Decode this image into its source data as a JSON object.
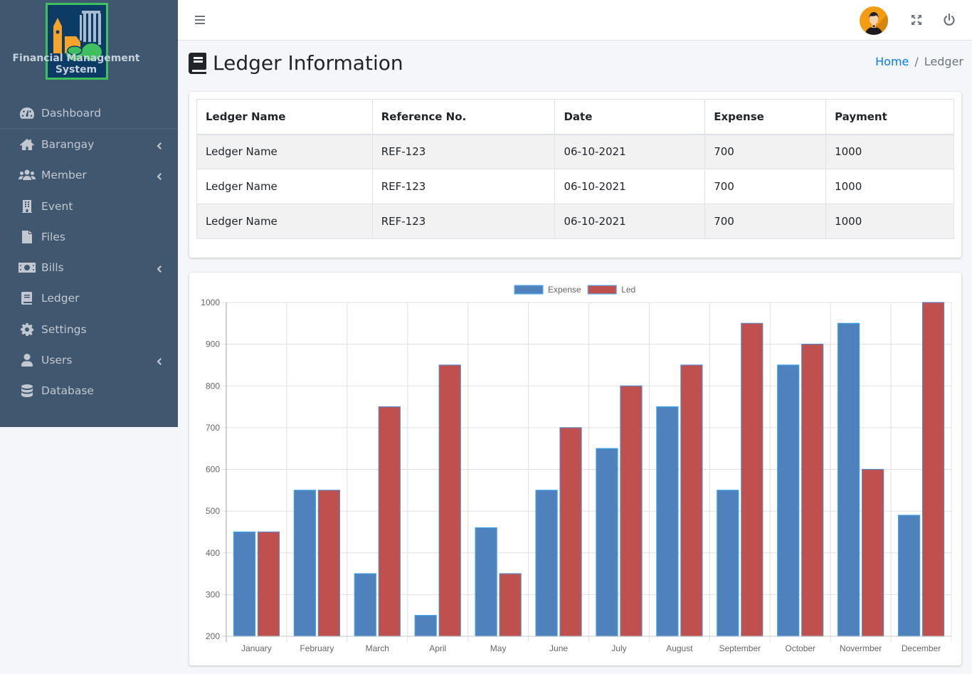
{
  "brand": {
    "title_line1": "Financial Management",
    "title_line2": "System"
  },
  "sidebar": {
    "items": [
      {
        "label": "Dashboard",
        "icon": "tachometer-icon",
        "has_submenu": false
      },
      {
        "label": "Barangay",
        "icon": "home-icon",
        "has_submenu": true
      },
      {
        "label": "Member",
        "icon": "users-icon",
        "has_submenu": true
      },
      {
        "label": "Event",
        "icon": "building-icon",
        "has_submenu": false
      },
      {
        "label": "Files",
        "icon": "file-icon",
        "has_submenu": false
      },
      {
        "label": "Bills",
        "icon": "money-bill-icon",
        "has_submenu": true
      },
      {
        "label": "Ledger",
        "icon": "book-icon",
        "has_submenu": false
      },
      {
        "label": "Settings",
        "icon": "gear-icon",
        "has_submenu": false
      },
      {
        "label": "Users",
        "icon": "user-icon",
        "has_submenu": true
      },
      {
        "label": "Database",
        "icon": "database-icon",
        "has_submenu": false
      }
    ]
  },
  "topbar": {
    "menu_icon": "hamburger-icon",
    "avatar": "user-avatar",
    "fullscreen_icon": "expand-icon",
    "logout_icon": "power-icon"
  },
  "page": {
    "title": "Ledger Information",
    "title_icon": "book-icon",
    "breadcrumb": {
      "home": "Home",
      "separator": "/",
      "current": "Ledger"
    }
  },
  "table": {
    "columns": [
      "Ledger Name",
      "Reference No.",
      "Date",
      "Expense",
      "Payment"
    ],
    "rows": [
      [
        "Ledger Name",
        "REF-123",
        "06-10-2021",
        "700",
        "1000"
      ],
      [
        "Ledger Name",
        "REF-123",
        "06-10-2021",
        "700",
        "1000"
      ],
      [
        "Ledger Name",
        "REF-123",
        "06-10-2021",
        "700",
        "1000"
      ]
    ]
  },
  "chart_data": {
    "type": "bar",
    "title": "",
    "xlabel": "",
    "ylabel": "",
    "categories": [
      "January",
      "February",
      "March",
      "April",
      "May",
      "June",
      "July",
      "August",
      "September",
      "October",
      "Novermber",
      "December"
    ],
    "series": [
      {
        "name": "Expense",
        "color": "#4f81bd",
        "border": "#3aa0e8",
        "values": [
          450,
          550,
          350,
          250,
          460,
          550,
          650,
          750,
          550,
          850,
          950,
          490
        ]
      },
      {
        "name": "Led",
        "color": "#c0504d",
        "border": "#5b86c0",
        "values": [
          450,
          550,
          750,
          850,
          350,
          700,
          800,
          850,
          950,
          900,
          600,
          1000
        ]
      }
    ],
    "ylim": [
      200,
      1000
    ],
    "yticks": [
      200,
      300,
      400,
      500,
      600,
      700,
      800,
      900,
      1000
    ],
    "grid": true,
    "legend_position": "top-center"
  },
  "colors": {
    "sidebar_bg": "#3f5870",
    "link": "#007bff",
    "avatar_bg": "#f39c12"
  }
}
